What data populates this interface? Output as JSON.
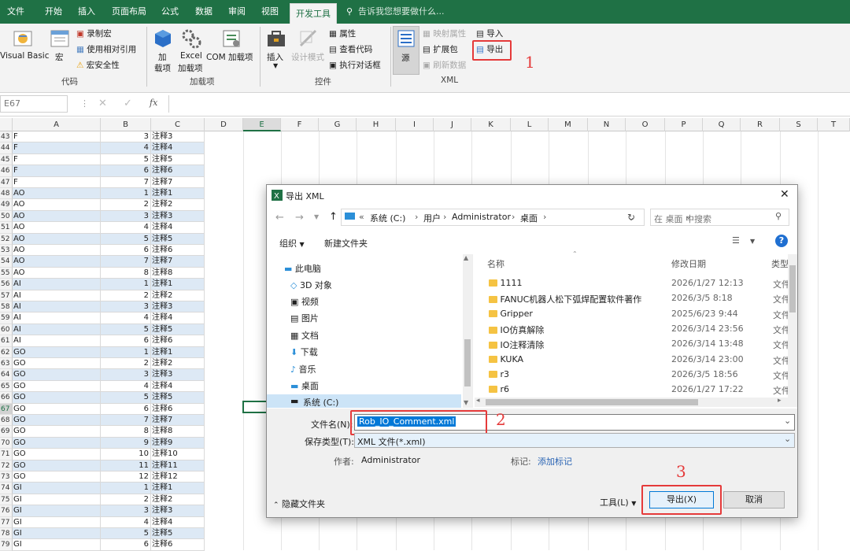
{
  "ribbon_tabs": [
    "文件",
    "开始",
    "插入",
    "页面布局",
    "公式",
    "数据",
    "审阅",
    "视图",
    "开发工具"
  ],
  "tell_me": "告诉我您想要做什么...",
  "code_group": {
    "visual_basic": "Visual Basic",
    "macros": "宏",
    "record_macro": "录制宏",
    "relative_refs": "使用相对引用",
    "macro_security": "宏安全性",
    "label": "代码"
  },
  "addins_group": {
    "addins_line1": "加",
    "addins_line2": "载项",
    "excel_line1": "Excel",
    "excel_line2": "加载项",
    "com": "COM 加载项",
    "label": "加载项"
  },
  "controls_group": {
    "insert": "插入",
    "design_mode": "设计模式",
    "properties": "属性",
    "view_code": "查看代码",
    "run_dialog": "执行对话框",
    "label": "控件"
  },
  "xml_group": {
    "source": "源",
    "map_properties": "映射属性",
    "expansion_packs": "扩展包",
    "refresh_data": "刷新数据",
    "import": "导入",
    "export": "导出",
    "label": "XML"
  },
  "annotations": {
    "step1": "1",
    "step2": "2",
    "step3": "3"
  },
  "formula_bar": {
    "name_box": "E67",
    "fx": "fx"
  },
  "columns": [
    "A",
    "B",
    "C",
    "D",
    "E",
    "F",
    "G",
    "H",
    "I",
    "J",
    "K",
    "L",
    "M",
    "N",
    "O",
    "P",
    "Q",
    "R",
    "S",
    "T"
  ],
  "rows": [
    {
      "n": "43",
      "a": "F",
      "b": "3",
      "c": "注释3"
    },
    {
      "n": "44",
      "a": "F",
      "b": "4",
      "c": "注释4"
    },
    {
      "n": "45",
      "a": "F",
      "b": "5",
      "c": "注释5"
    },
    {
      "n": "46",
      "a": "F",
      "b": "6",
      "c": "注释6"
    },
    {
      "n": "47",
      "a": "F",
      "b": "7",
      "c": "注释7"
    },
    {
      "n": "48",
      "a": "AO",
      "b": "1",
      "c": "注释1"
    },
    {
      "n": "49",
      "a": "AO",
      "b": "2",
      "c": "注释2"
    },
    {
      "n": "50",
      "a": "AO",
      "b": "3",
      "c": "注释3"
    },
    {
      "n": "51",
      "a": "AO",
      "b": "4",
      "c": "注释4"
    },
    {
      "n": "52",
      "a": "AO",
      "b": "5",
      "c": "注释5"
    },
    {
      "n": "53",
      "a": "AO",
      "b": "6",
      "c": "注释6"
    },
    {
      "n": "54",
      "a": "AO",
      "b": "7",
      "c": "注释7"
    },
    {
      "n": "55",
      "a": "AO",
      "b": "8",
      "c": "注释8"
    },
    {
      "n": "56",
      "a": "AI",
      "b": "1",
      "c": "注释1"
    },
    {
      "n": "57",
      "a": "AI",
      "b": "2",
      "c": "注释2"
    },
    {
      "n": "58",
      "a": "AI",
      "b": "3",
      "c": "注释3"
    },
    {
      "n": "59",
      "a": "AI",
      "b": "4",
      "c": "注释4"
    },
    {
      "n": "60",
      "a": "AI",
      "b": "5",
      "c": "注释5"
    },
    {
      "n": "61",
      "a": "AI",
      "b": "6",
      "c": "注释6"
    },
    {
      "n": "62",
      "a": "GO",
      "b": "1",
      "c": "注释1"
    },
    {
      "n": "63",
      "a": "GO",
      "b": "2",
      "c": "注释2"
    },
    {
      "n": "64",
      "a": "GO",
      "b": "3",
      "c": "注释3"
    },
    {
      "n": "65",
      "a": "GO",
      "b": "4",
      "c": "注释4"
    },
    {
      "n": "66",
      "a": "GO",
      "b": "5",
      "c": "注释5"
    },
    {
      "n": "67",
      "a": "GO",
      "b": "6",
      "c": "注释6"
    },
    {
      "n": "68",
      "a": "GO",
      "b": "7",
      "c": "注释7"
    },
    {
      "n": "69",
      "a": "GO",
      "b": "8",
      "c": "注释8"
    },
    {
      "n": "70",
      "a": "GO",
      "b": "9",
      "c": "注释9"
    },
    {
      "n": "71",
      "a": "GO",
      "b": "10",
      "c": "注释10"
    },
    {
      "n": "72",
      "a": "GO",
      "b": "11",
      "c": "注释11"
    },
    {
      "n": "73",
      "a": "GO",
      "b": "12",
      "c": "注释12"
    },
    {
      "n": "74",
      "a": "GI",
      "b": "1",
      "c": "注释1"
    },
    {
      "n": "75",
      "a": "GI",
      "b": "2",
      "c": "注释2"
    },
    {
      "n": "76",
      "a": "GI",
      "b": "3",
      "c": "注释3"
    },
    {
      "n": "77",
      "a": "GI",
      "b": "4",
      "c": "注释4"
    },
    {
      "n": "78",
      "a": "GI",
      "b": "5",
      "c": "注释5"
    },
    {
      "n": "79",
      "a": "GI",
      "b": "6",
      "c": "注释6"
    }
  ],
  "dialog": {
    "title": "导出 XML",
    "breadcrumb": [
      "«",
      "系统 (C:)",
      "用户",
      "Administrator",
      "桌面"
    ],
    "search_placeholder": "在 桌面 中搜索",
    "organize": "组织",
    "new_folder": "新建文件夹",
    "nav": [
      "此电脑",
      "3D 对象",
      "视频",
      "图片",
      "文档",
      "下载",
      "音乐",
      "桌面",
      "系统 (C:)"
    ],
    "col_name": "名称",
    "col_date": "修改日期",
    "col_type": "类型",
    "files": [
      {
        "name": "1111",
        "date": "2026/1/27 12:13",
        "type": "文件"
      },
      {
        "name": "FANUC机器人松下弧焊配置软件著作",
        "date": "2026/3/5 8:18",
        "type": "文件"
      },
      {
        "name": "Gripper",
        "date": "2025/6/23 9:44",
        "type": "文件"
      },
      {
        "name": "IO仿真解除",
        "date": "2026/3/14 23:56",
        "type": "文件"
      },
      {
        "name": "IO注释清除",
        "date": "2026/3/14 13:48",
        "type": "文件"
      },
      {
        "name": "KUKA",
        "date": "2026/3/14 23:00",
        "type": "文件"
      },
      {
        "name": "r3",
        "date": "2026/3/5 18:56",
        "type": "文件"
      },
      {
        "name": "r6",
        "date": "2026/1/27 17:22",
        "type": "文件"
      }
    ],
    "filename_label": "文件名(N):",
    "filename_value": "Rob_IO_Comment.xml",
    "savetype_label": "保存类型(T):",
    "savetype_value": "XML 文件(*.xml)",
    "author_label": "作者:",
    "author_value": "Administrator",
    "tags_label": "标记:",
    "tags_value": "添加标记",
    "hide_folders": "隐藏文件夹",
    "tools": "工具(L)",
    "export_btn": "导出(X)",
    "cancel_btn": "取消"
  }
}
